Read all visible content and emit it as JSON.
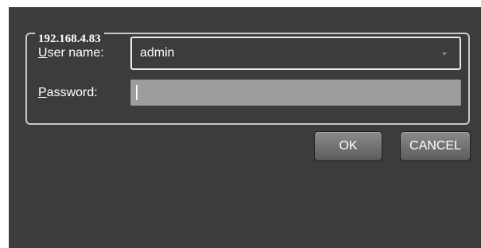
{
  "login": {
    "group_title": "192.168.4.83",
    "username": {
      "label_accel": "U",
      "label_rest": "ser name:",
      "value": "admin"
    },
    "password": {
      "label_accel": "P",
      "label_rest": "assword:",
      "value": ""
    }
  },
  "buttons": {
    "ok": "OK",
    "cancel": "CANCEL"
  },
  "icons": {
    "combo_arrow": "chevron-down-icon"
  }
}
